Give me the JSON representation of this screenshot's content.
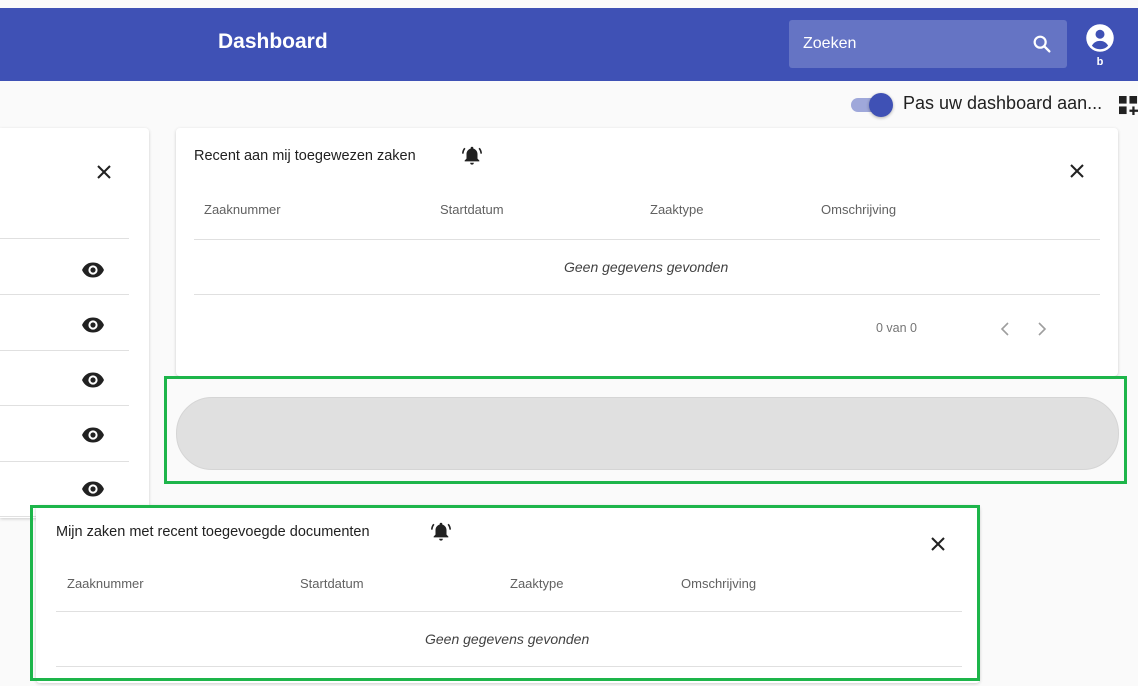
{
  "header": {
    "title": "Dashboard",
    "search_placeholder": "Zoeken",
    "search_icon": "search-icon",
    "user_icon": "account-circle-icon",
    "user_initial": "b"
  },
  "toolbar": {
    "toggle_label": "Pas uw dashboard aan...",
    "toggle_on": true,
    "add_widget_icon": "dashboard-customize-icon"
  },
  "cards": {
    "assigned": {
      "title": "Recent aan mij toegewezen zaken",
      "bell_icon": "bell-icon",
      "columns": [
        "Zaaknummer",
        "Startdatum",
        "Zaaktype",
        "Omschrijving"
      ],
      "empty_message": "Geen gegevens gevonden",
      "pager": {
        "range": "0 van 0"
      }
    },
    "documents": {
      "title": "Mijn zaken met recent toegevoegde documenten",
      "bell_icon": "bell-icon",
      "columns": [
        "Zaaknummer",
        "Startdatum",
        "Zaaktype",
        "Omschrijving"
      ],
      "empty_message": "Geen gegevens gevonden"
    },
    "left": {
      "row_icon": "eye-icon",
      "row_count": 5
    }
  },
  "colors": {
    "primary": "#3f51b5",
    "search_bg": "#6574c4",
    "highlight": "#1db54a",
    "placeholder_bg": "#e0e0e0"
  }
}
